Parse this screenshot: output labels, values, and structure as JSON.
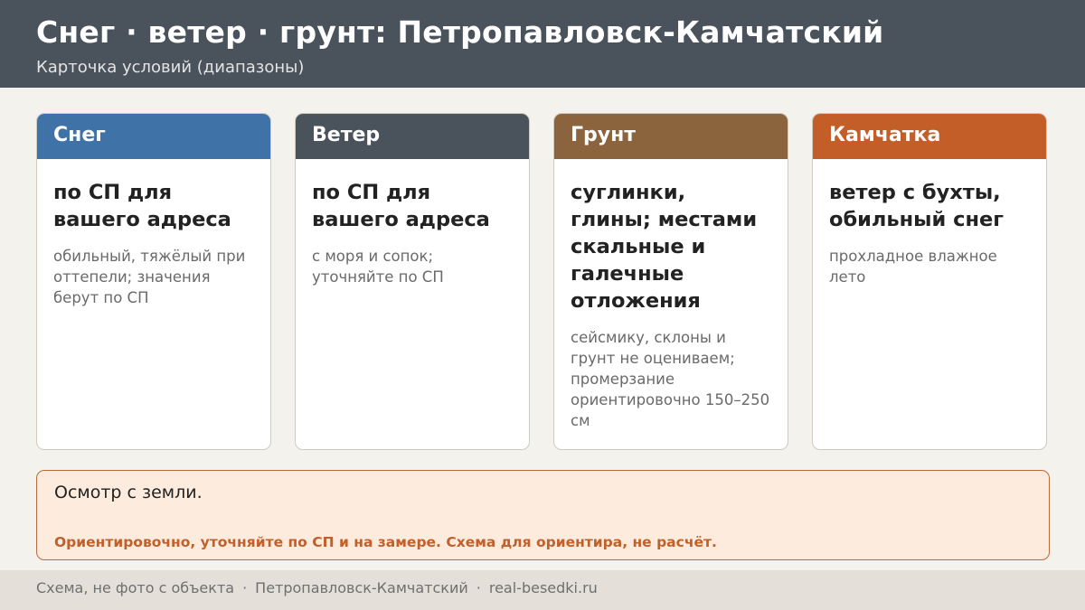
{
  "header": {
    "title": "Снег · ветер · грунт: Петропавловск-Камчатский",
    "subtitle": "Карточка условий (диапазоны)"
  },
  "cards": [
    {
      "title": "Снег",
      "main": "по СП для вашего адреса",
      "note": "обильный, тяжёлый при оттепели; значения берут по СП",
      "color": "#3f73a8"
    },
    {
      "title": "Ветер",
      "main": "по СП для вашего адреса",
      "note": "с моря и сопок; уточняйте по СП",
      "color": "#4a525c"
    },
    {
      "title": "Грунт",
      "main": "суглинки, глины; местами скальные и галечные отложения",
      "note": "сейсмику, склоны и грунт не оцениваем; промерзание ориентировочно 150–250 см",
      "color": "#8b633c"
    },
    {
      "title": "Камчатка",
      "main": "ветер с бухты, обильный снег",
      "note": "прохладное влажное лето",
      "color": "#c35e28"
    }
  ],
  "note_box": {
    "main": "Осмотр с земли.",
    "warning": "Ориентировочно, уточняйте по СП и на замере. Схема для ориентира, не расчёт."
  },
  "footer": {
    "part1": "Схема, не фото с объекта",
    "separator": "·",
    "part2": "Петропавловск-Камчатский",
    "part3": "real-besedki.ru"
  }
}
